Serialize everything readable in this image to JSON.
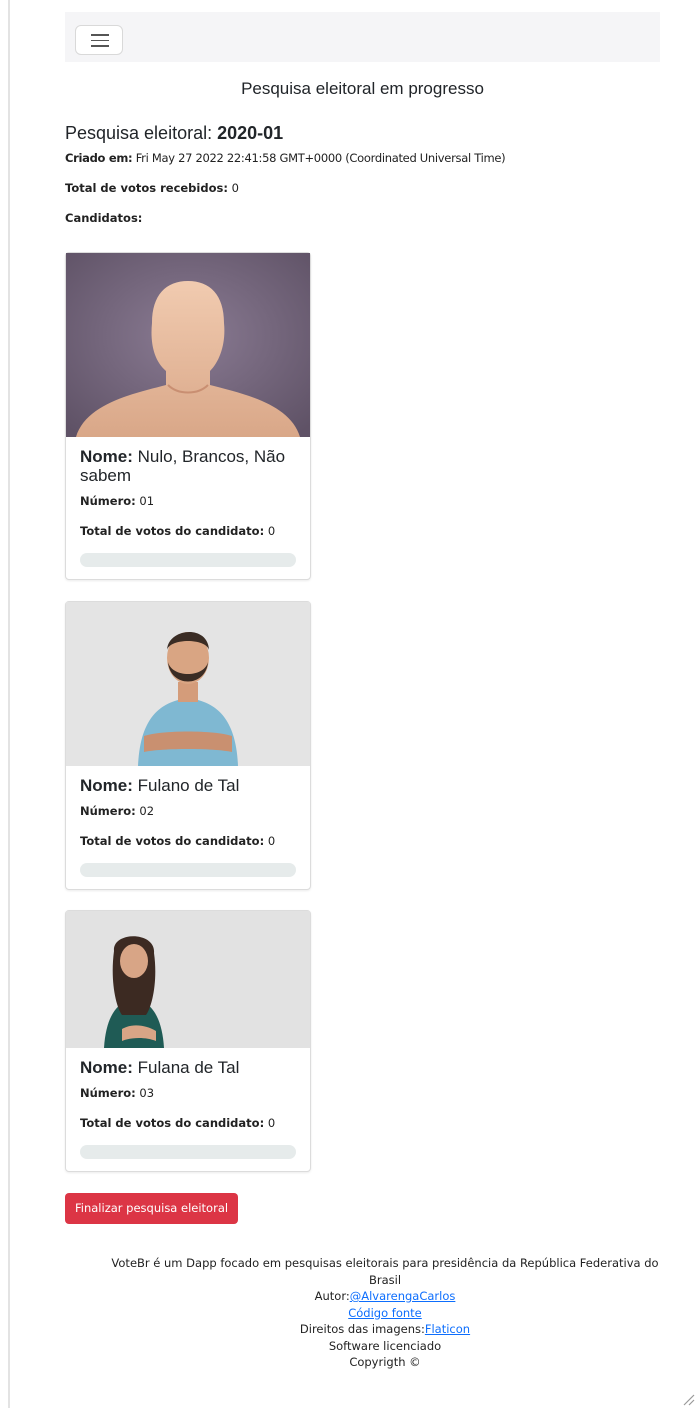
{
  "page": {
    "heading": "Pesquisa eleitoral em progresso",
    "poll_label": "Pesquisa eleitoral: ",
    "poll_id": "2020-01",
    "created_label": "Criado em:",
    "created_value": " Fri May 27 2022 22:41:58 GMT+0000 (Coordinated Universal Time)",
    "total_label": "Total de votos recebidos:",
    "total_value": " 0",
    "candidates_label": "Candidatos:"
  },
  "candidates": [
    {
      "name_label": "Nome:",
      "name": " Nulo, Brancos, Não sabem",
      "number_label": "Número:",
      "number": " 01",
      "votes_label": "Total de votos do candidato:",
      "votes": " 0",
      "progress": 0
    },
    {
      "name_label": "Nome:",
      "name": " Fulano de Tal",
      "number_label": "Número:",
      "number": " 02",
      "votes_label": "Total de votos do candidato:",
      "votes": " 0",
      "progress": 0
    },
    {
      "name_label": "Nome:",
      "name": " Fulana de Tal",
      "number_label": "Número:",
      "number": " 03",
      "votes_label": "Total de votos do candidato:",
      "votes": " 0",
      "progress": 0
    }
  ],
  "actions": {
    "finish_label": "Finalizar pesquisa eleitoral"
  },
  "footer": {
    "line1": "VoteBr é um Dapp focado em pesquisas eleitorais para presidência da República Federativa do Brasil",
    "author_label": "Autor:",
    "author_link": "@AlvarengaCarlos",
    "source_link": "Código fonte",
    "images_label": "Direitos das imagens:",
    "images_link": "Flaticon",
    "license": "Software licenciado",
    "copyright": "Copyrigth ©"
  },
  "colors": {
    "danger": "#dc3545",
    "link": "#0d6efd",
    "navbar_bg": "#f5f5f7",
    "progress_track": "#e6ebeb"
  },
  "icons": {
    "menu": "hamburger-menu-icon",
    "resize": "resize-grip-icon"
  }
}
